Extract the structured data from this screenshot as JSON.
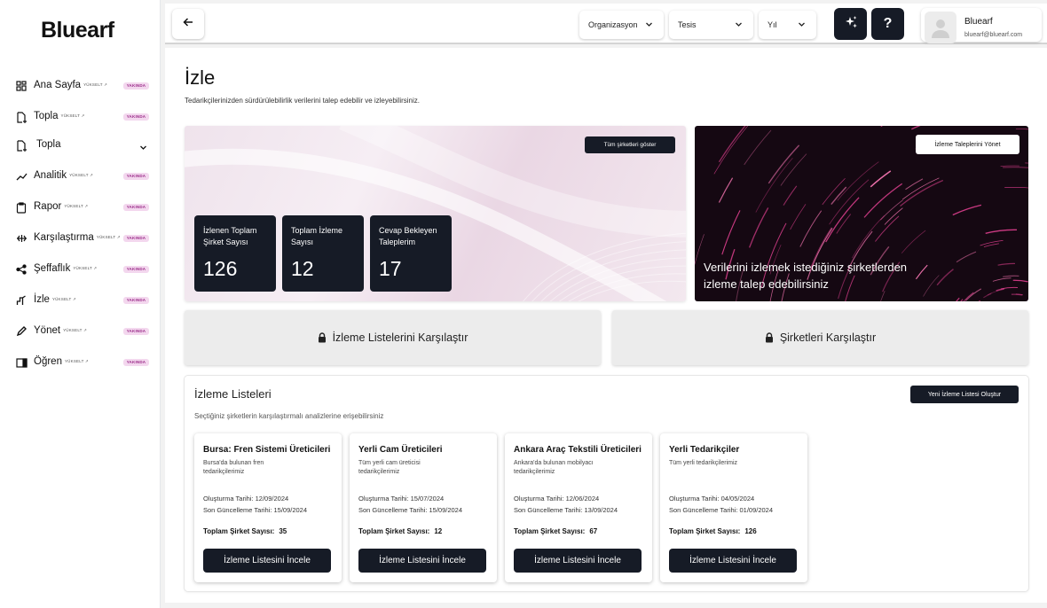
{
  "sidebar": {
    "logo": "Bluearf",
    "items": [
      {
        "label": "Ana Sayfa",
        "upgrade": "YÜKSELT ↗",
        "soon": "YAKINDA",
        "icon": "dashboard-grid-icon"
      },
      {
        "label": "Topla",
        "upgrade": "YÜKSELT ↗",
        "soon": "YAKINDA",
        "icon": "document-collect-icon"
      },
      {
        "label": "Topla",
        "icon": "document-collect-icon"
      },
      {
        "label": "Analitik",
        "upgrade": "YÜKSELT ↗",
        "soon": "YAKINDA",
        "icon": "trend-line-icon"
      },
      {
        "label": "Rapor",
        "upgrade": "YÜKSELT ↗",
        "soon": "YAKINDA",
        "icon": "clipboard-icon"
      },
      {
        "label": "Karşılaştırma",
        "upgrade": "YÜKSELT ↗",
        "soon": "YAKINDA",
        "icon": "compare-arrows-icon"
      },
      {
        "label": "Şeffaflık",
        "upgrade": "YÜKSELT ↗",
        "soon": "YAKINDA",
        "icon": "share-icon"
      },
      {
        "label": "İzle",
        "upgrade": "YÜKSELT ↗",
        "soon": "YAKINDA",
        "icon": "monitor-chart-icon"
      },
      {
        "label": "Yönet",
        "upgrade": "YÜKSELT ↗",
        "soon": "YAKINDA",
        "icon": "pencil-icon"
      },
      {
        "label": "Öğren",
        "upgrade": "YÜKSELT ↗",
        "soon": "YAKINDA",
        "icon": "learn-panel-icon"
      }
    ]
  },
  "topbar": {
    "filters": {
      "organization": "Organizasyon",
      "facility": "Tesis",
      "year": "Yıl"
    },
    "help_label": "?",
    "user": {
      "name": "Bluearf",
      "email": "bluearf@bluearf.com"
    }
  },
  "page": {
    "title": "İzle",
    "subtitle": "Tedarikçilerinizden sürdürülebilirlik verilerini talep edebilir ve izleyebilirsiniz."
  },
  "hero": {
    "show_all_label": "Tüm şirketleri göster",
    "stats": [
      {
        "label": "İzlenen Toplam Şirket Sayısı",
        "value": "126"
      },
      {
        "label": "Toplam İzleme Sayısı",
        "value": "12"
      },
      {
        "label": "Cevap Bekleyen Taleplerim",
        "value": "17"
      }
    ],
    "manage_label": "İzleme Taleplerini Yönet",
    "right_text": "Verilerini izlemek istediğiniz şirketlerden izleme talep edebilirsiniz"
  },
  "compare": {
    "lists_label": "İzleme Listelerini Karşılaştır",
    "companies_label": "Şirketleri Karşılaştır"
  },
  "lists": {
    "title": "İzleme Listeleri",
    "subtitle": "Seçtiğiniz şirketlerin karşılaştırmalı analizlerine erişebilirsiniz",
    "new_label": "Yeni İzleme Listesi Oluştur",
    "count_label": "Toplam Şirket Sayısı:",
    "view_label": "İzleme Listesini İncele",
    "cards": [
      {
        "title": "Bursa: Fren Sistemi Üreticileri",
        "desc": "Bursa'da bulunan fren tedarikçilerimiz",
        "created": "Oluşturma Tarihi: 12/09/2024",
        "updated": "Son Güncelleme Tarihi: 15/09/2024",
        "count": "35"
      },
      {
        "title": "Yerli Cam Üreticileri",
        "desc": "Tüm yerli cam üreticisi tedarikçilerimiz",
        "created": "Oluşturma Tarihi: 15/07/2024",
        "updated": "Son Güncelleme Tarihi: 15/09/2024",
        "count": "12"
      },
      {
        "title": "Ankara Araç Tekstili Üreticileri",
        "desc": "Ankara'da bulunan mobilyacı tedarikçilerimiz",
        "created": "Oluşturma Tarihi: 12/06/2024",
        "updated": "Son Güncelleme Tarihi: 13/09/2024",
        "count": "67"
      },
      {
        "title": "Yerli Tedarikçiler",
        "desc": "Tüm yerli tedarikçilerimiz",
        "created": "Oluşturma Tarihi: 04/05/2024",
        "updated": "Son Güncelleme Tarihi: 01/09/2024",
        "count": "126"
      }
    ]
  }
}
